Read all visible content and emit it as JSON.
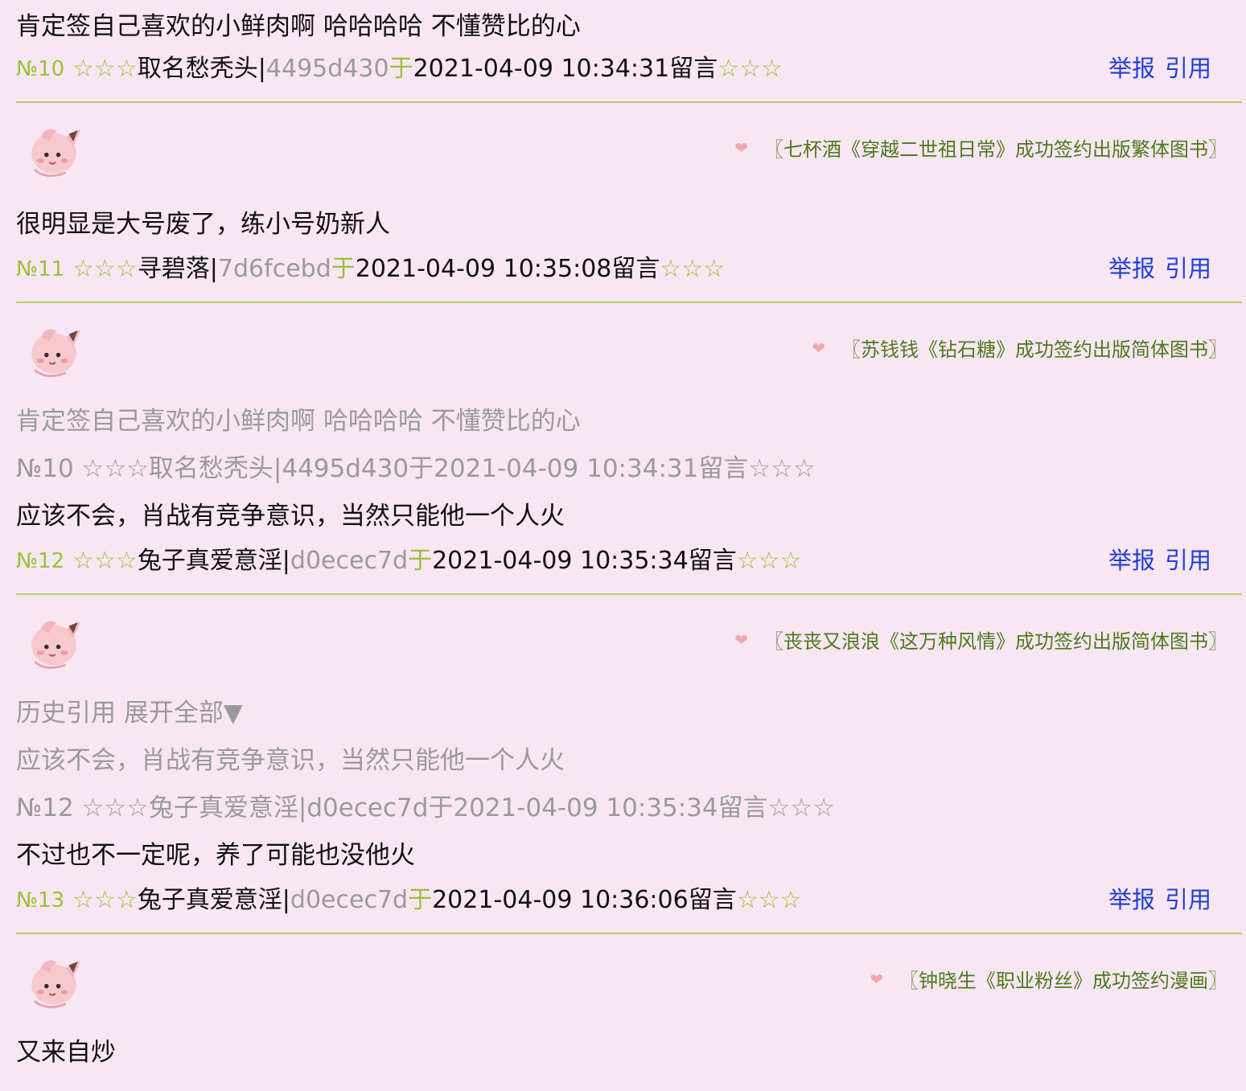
{
  "colors": {
    "background": "#f9e6f3",
    "accent_green": "#9ac13a",
    "link_blue": "#1e3fd6",
    "divider": "#b9cf6a",
    "sign_text": "#4c7a1d"
  },
  "actions": {
    "report": "举报",
    "quote": "引用"
  },
  "top": {
    "text": "肯定签自己喜欢的小鲜肉啊 哈哈哈哈 不懂赞比的心",
    "meta": {
      "no": "№10",
      "stars_l": "☆☆☆",
      "name": "取名愁秃头|",
      "id": "4495d430",
      "yu": "于",
      "time": "2021-04-09 10:34:31留言",
      "stars_r": "☆☆☆"
    }
  },
  "posts": [
    {
      "sign": "〖七杯酒《穿越二世祖日常》成功签约出版繁体图书〗",
      "text": "很明显是大号废了，练小号奶新人",
      "meta": {
        "no": "№11",
        "stars_l": "☆☆☆",
        "name": "寻碧落|",
        "id": "7d6fcebd",
        "yu": "于",
        "time": "2021-04-09 10:35:08留言",
        "stars_r": "☆☆☆"
      }
    },
    {
      "sign": "〖苏钱钱《钻石糖》成功签约出版简体图书〗",
      "quote": {
        "text": "肯定签自己喜欢的小鲜肉啊 哈哈哈哈 不懂赞比的心",
        "meta": "№10 ☆☆☆取名愁秃头|4495d430于2021-04-09 10:34:31留言☆☆☆"
      },
      "text": "应该不会，肖战有竞争意识，当然只能他一个人火",
      "meta": {
        "no": "№12",
        "stars_l": "☆☆☆",
        "name": "兔子真爱意淫|",
        "id": "d0ecec7d",
        "yu": "于",
        "time": "2021-04-09 10:35:34留言",
        "stars_r": "☆☆☆"
      }
    },
    {
      "sign": "〖丧丧又浪浪《这万种风情》成功签约出版简体图书〗",
      "history": "历史引用 展开全部▼",
      "quote": {
        "text": "应该不会，肖战有竞争意识，当然只能他一个人火",
        "meta": "№12 ☆☆☆兔子真爱意淫|d0ecec7d于2021-04-09 10:35:34留言☆☆☆"
      },
      "text": "不过也不一定呢，养了可能也没他火",
      "meta": {
        "no": "№13",
        "stars_l": "☆☆☆",
        "name": "兔子真爱意淫|",
        "id": "d0ecec7d",
        "yu": "于",
        "time": "2021-04-09 10:36:06留言",
        "stars_r": "☆☆☆"
      }
    },
    {
      "sign": "〖钟晓生《职业粉丝》成功签约漫画〗",
      "text": "又来自炒"
    }
  ]
}
